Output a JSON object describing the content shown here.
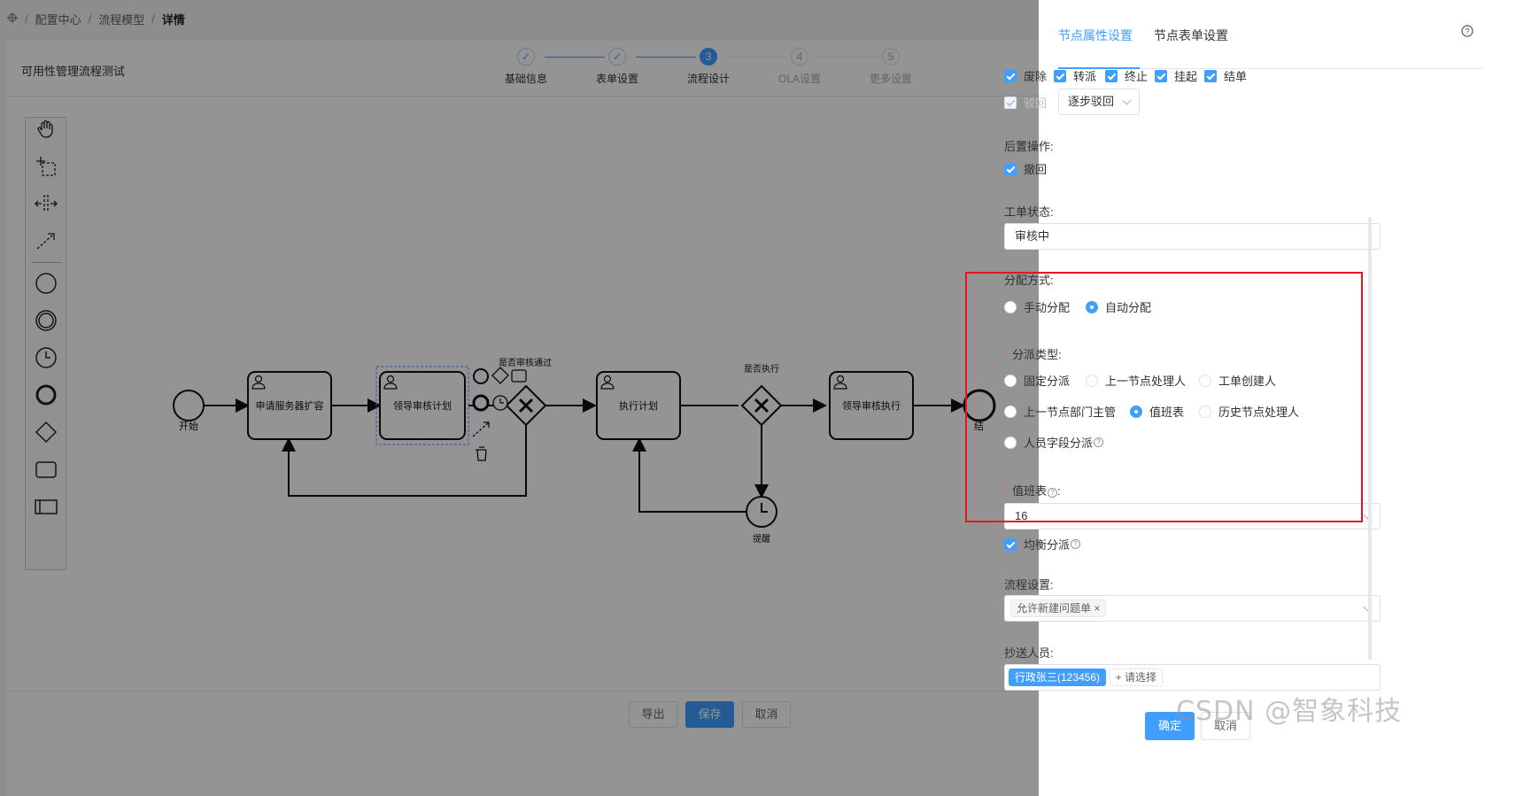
{
  "breadcrumb": {
    "items": [
      "配置中心",
      "流程模型"
    ],
    "current": "详情"
  },
  "process": {
    "title": "可用性管理流程测试"
  },
  "steps": [
    {
      "label": "基础信息",
      "state": "done",
      "num": ""
    },
    {
      "label": "表单设置",
      "state": "done",
      "num": ""
    },
    {
      "label": "流程设计",
      "state": "active",
      "num": "3"
    },
    {
      "label": "OLA设置",
      "state": "todo",
      "num": "4"
    },
    {
      "label": "更多设置",
      "state": "todo",
      "num": "5"
    }
  ],
  "diagram": {
    "start_label": "开始",
    "tasks": [
      "申请服务器扩容",
      "领导审核计划",
      "执行计划",
      "领导审核执行"
    ],
    "gateway1_label": "是否审核通过",
    "gateway2_label": "是否执行",
    "timer_label": "提醒",
    "end_label": "结"
  },
  "footer": {
    "export": "导出",
    "save": "保存",
    "cancel": "取消"
  },
  "drawer": {
    "tabs": [
      "节点属性设置",
      "节点表单设置"
    ],
    "ops": [
      "废除",
      "转派",
      "终止",
      "挂起",
      "结单"
    ],
    "reject_label": "驳回",
    "reject_mode": "逐步驳回",
    "post_ops_label": "后置操作:",
    "post_ops": [
      "撤回"
    ],
    "status_label": "工单状态:",
    "status_value": "审核中",
    "assign_label": "分配方式:",
    "assign_options": [
      "手动分配",
      "自动分配"
    ],
    "assign_selected": "自动分配",
    "dispatch_label": "分派类型:",
    "dispatch_options": [
      "固定分派",
      "上一节点处理人",
      "工单创建人",
      "上一节点部门主管",
      "值班表",
      "历史节点处理人",
      "人员字段分派"
    ],
    "dispatch_selected": "值班表",
    "duty_label": "值班表",
    "duty_value": "16",
    "balance_label": "均衡分派",
    "flow_label": "流程设置:",
    "flow_tag": "允许新建问题单",
    "cc_label": "抄送人员:",
    "cc_tag": "行政张三(123456)",
    "cc_add": "+ 请选择",
    "confirm": "确定",
    "cancel": "取消"
  },
  "watermark": "CSDN @智象科技"
}
